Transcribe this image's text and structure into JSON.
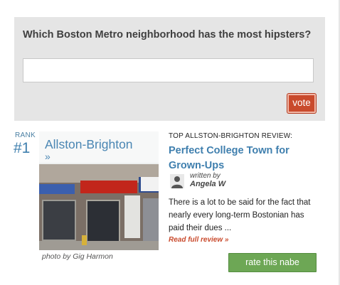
{
  "poll": {
    "question": "Which Boston Metro neighborhood has the most hipsters?",
    "input_value": "",
    "input_placeholder": "",
    "vote_label": "vote",
    "vote_color": "#c94a2c"
  },
  "rank": {
    "label": "RANK",
    "number": "#1"
  },
  "neighborhood": {
    "name": "Allston-Brighton",
    "arrow": "»",
    "photo_credit": "photo by Gig Harmon"
  },
  "review": {
    "kicker": "TOP ALLSTON-BRIGHTON REVIEW:",
    "title": "Perfect College Town for Grown-Ups",
    "written_by": "written by",
    "author": "Angela W",
    "author_icon": "user-silhouette-icon",
    "excerpt": "There is a lot to be said for the fact that nearly every long-term Bostonian has paid their dues ...",
    "read_more": "Read full review »",
    "title_color": "#3f7fae"
  },
  "actions": {
    "rate_label": "rate this nabe",
    "rate_color": "#6da755"
  }
}
